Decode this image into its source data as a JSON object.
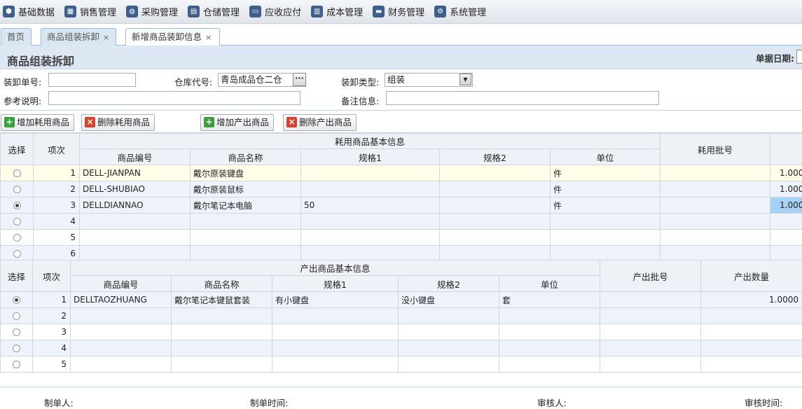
{
  "menu": [
    {
      "label": "基础数据",
      "icon": "box-icon",
      "glyph": "⬢"
    },
    {
      "label": "销售管理",
      "icon": "list-icon",
      "glyph": "▦"
    },
    {
      "label": "采购管理",
      "icon": "basket-icon",
      "glyph": "◍"
    },
    {
      "label": "仓储管理",
      "icon": "warehouse-icon",
      "glyph": "▤"
    },
    {
      "label": "应收应付",
      "icon": "card-icon",
      "glyph": "▭"
    },
    {
      "label": "成本管理",
      "icon": "book-icon",
      "glyph": "▥"
    },
    {
      "label": "财务管理",
      "icon": "money-icon",
      "glyph": "▬"
    },
    {
      "label": "系统管理",
      "icon": "gear-icon",
      "glyph": "⚙"
    }
  ],
  "tabs": [
    {
      "label": "首页"
    },
    {
      "label": "商品组装拆卸",
      "close": "×"
    },
    {
      "label": "新增商品装卸信息",
      "close": "×"
    }
  ],
  "page": {
    "title": "商品组装拆卸",
    "date_label": "单据日期:"
  },
  "form": {
    "bill_no_label": "装卸单号:",
    "bill_no_value": "",
    "warehouse_label": "仓库代号:",
    "warehouse_value": "青岛成品仓二仓",
    "ellipsis": "···",
    "type_label": "装卸类型:",
    "type_value": "组装",
    "ref_label": "参考说明:",
    "ref_value": "",
    "remark_label": "备注信息:",
    "remark_value": ""
  },
  "toolbar": {
    "add_consume": "增加耗用商品",
    "del_consume": "删除耗用商品",
    "add_output": "增加产出商品",
    "del_output": "删除产出商品",
    "add_glyph": "+",
    "del_glyph": "×"
  },
  "consume_table": {
    "col_select": "选择",
    "col_index": "项次",
    "group_title": "耗用商品基本信息",
    "col_code": "商品编号",
    "col_name": "商品名称",
    "col_spec1": "规格1",
    "col_spec2": "规格2",
    "col_unit": "单位",
    "col_batch": "耗用批号",
    "rows": [
      {
        "idx": "1",
        "code": "DELL-JIANPAN",
        "name": "戴尔原装键盘",
        "spec1": "",
        "spec2": "",
        "unit": "件",
        "batch": "",
        "qty": "1.0000",
        "checked": false
      },
      {
        "idx": "2",
        "code": "DELL-SHUBIAO",
        "name": "戴尔原装鼠标",
        "spec1": "",
        "spec2": "",
        "unit": "件",
        "batch": "",
        "qty": "1.0000",
        "checked": false
      },
      {
        "idx": "3",
        "code": "DELLDIANNAO",
        "name": "戴尔笔记本电脑",
        "spec1": "50",
        "spec2": "",
        "unit": "件",
        "batch": "",
        "qty": "1.0000",
        "checked": true
      },
      {
        "idx": "4",
        "code": "",
        "name": "",
        "spec1": "",
        "spec2": "",
        "unit": "",
        "batch": "",
        "qty": "",
        "checked": false
      },
      {
        "idx": "5",
        "code": "",
        "name": "",
        "spec1": "",
        "spec2": "",
        "unit": "",
        "batch": "",
        "qty": "",
        "checked": false
      },
      {
        "idx": "6",
        "code": "",
        "name": "",
        "spec1": "",
        "spec2": "",
        "unit": "",
        "batch": "",
        "qty": "",
        "checked": false
      }
    ]
  },
  "output_table": {
    "col_select": "选择",
    "col_index": "项次",
    "group_title": "产出商品基本信息",
    "col_code": "商品编号",
    "col_name": "商品名称",
    "col_spec1": "规格1",
    "col_spec2": "规格2",
    "col_unit": "单位",
    "col_batch": "产出批号",
    "col_qty": "产出数量",
    "rows": [
      {
        "idx": "1",
        "code": "DELLTAOZHUANG",
        "name": "戴尔笔记本键鼠套装",
        "spec1": "有小键盘",
        "spec2": "没小键盘",
        "unit": "套",
        "batch": "",
        "qty": "1.0000",
        "checked": true
      },
      {
        "idx": "2",
        "code": "",
        "name": "",
        "spec1": "",
        "spec2": "",
        "unit": "",
        "batch": "",
        "qty": "",
        "checked": false
      },
      {
        "idx": "3",
        "code": "",
        "name": "",
        "spec1": "",
        "spec2": "",
        "unit": "",
        "batch": "",
        "qty": "",
        "checked": false
      },
      {
        "idx": "4",
        "code": "",
        "name": "",
        "spec1": "",
        "spec2": "",
        "unit": "",
        "batch": "",
        "qty": "",
        "checked": false
      },
      {
        "idx": "5",
        "code": "",
        "name": "",
        "spec1": "",
        "spec2": "",
        "unit": "",
        "batch": "",
        "qty": "",
        "checked": false
      }
    ]
  },
  "footer": {
    "creator_label": "制单人:",
    "create_time_label": "制单时间:",
    "auditor_label": "审核人:",
    "audit_time_label": "审核时间:"
  }
}
